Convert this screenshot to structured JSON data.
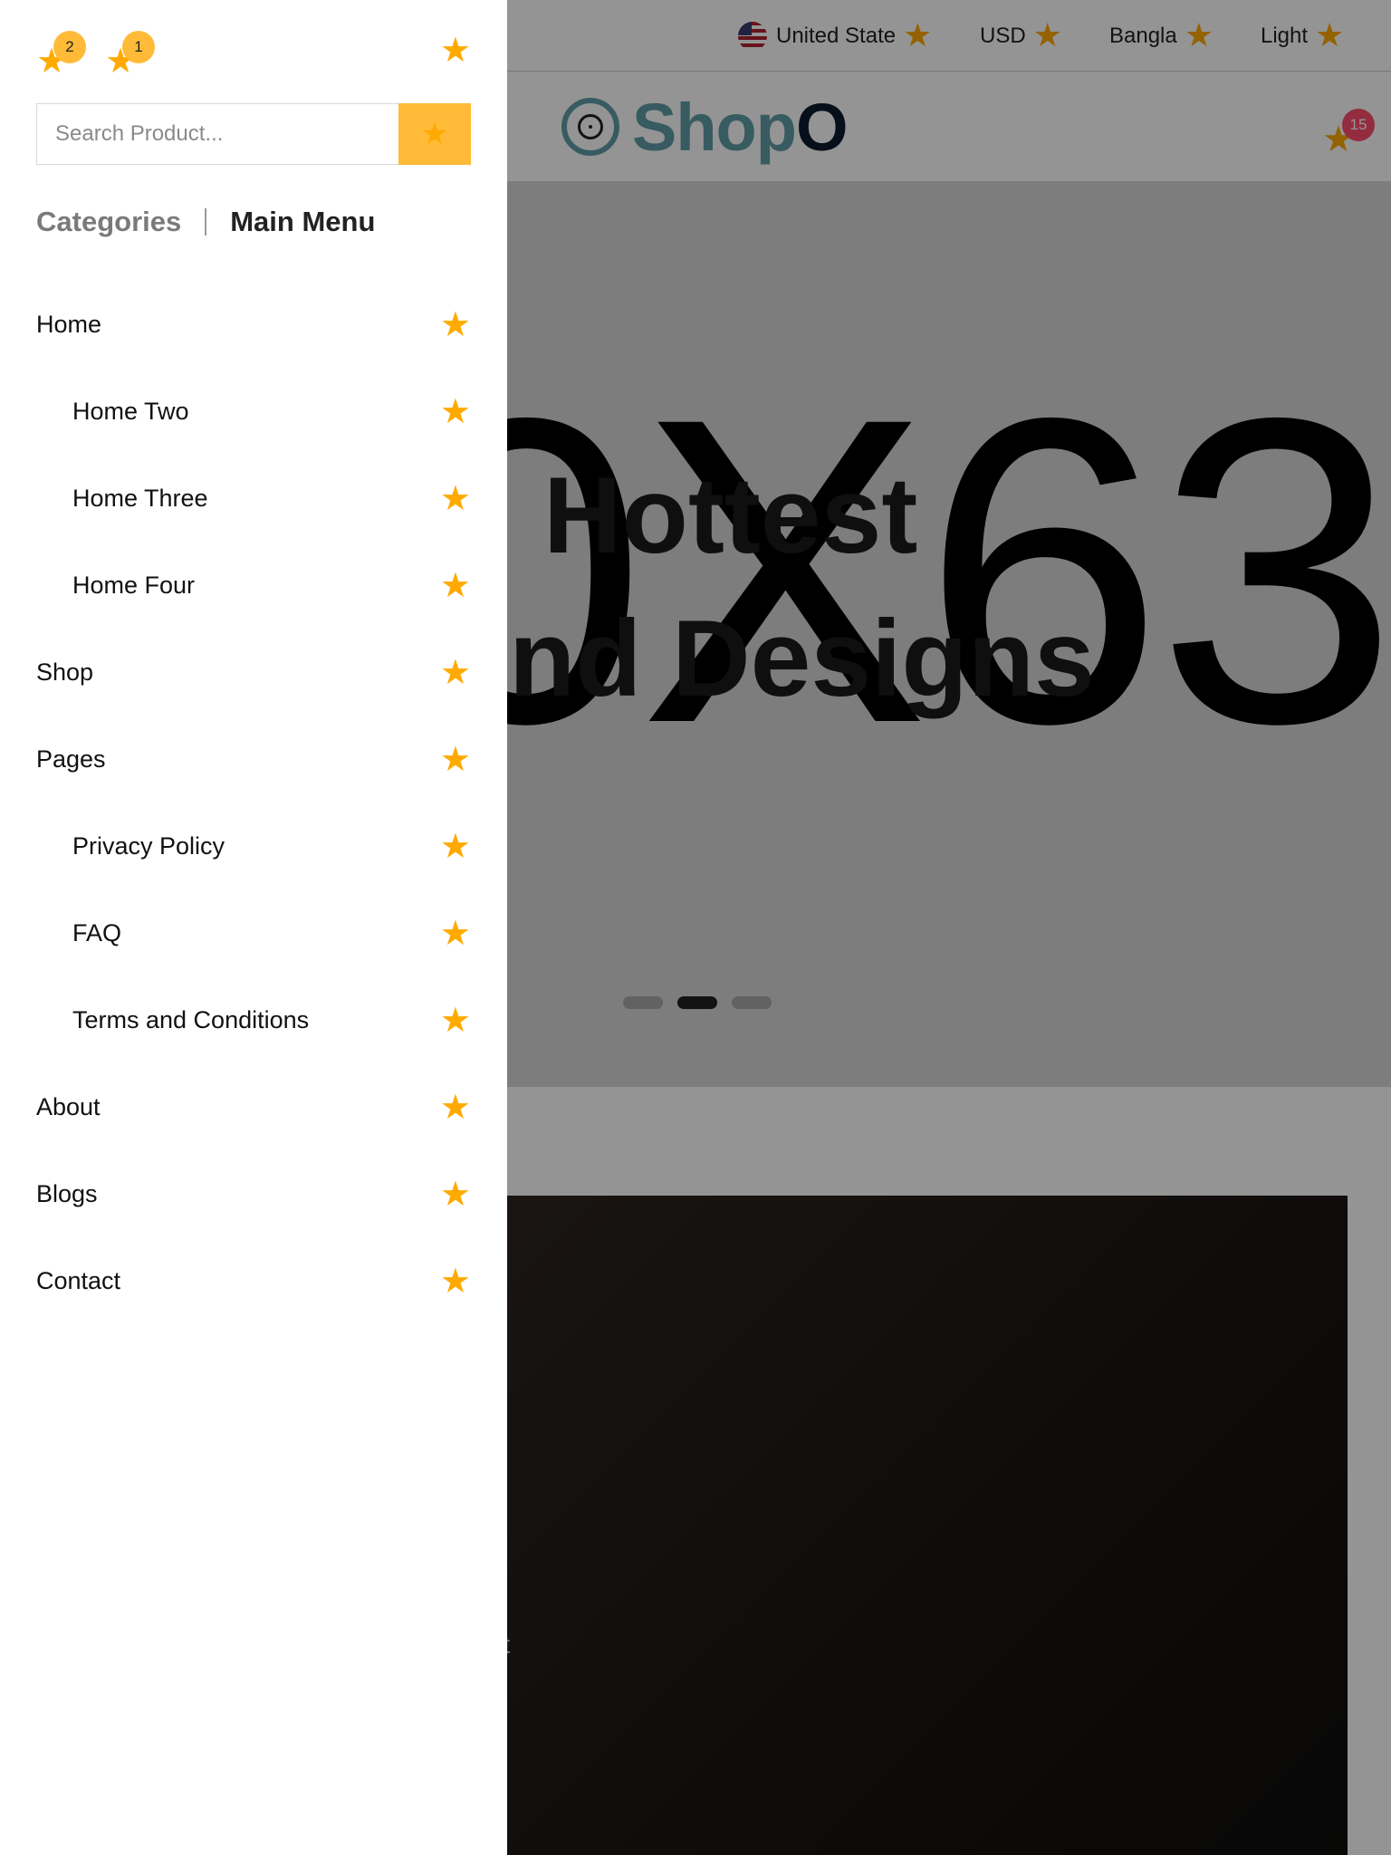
{
  "topbar": {
    "country": "United State",
    "currency": "USD",
    "language": "Bangla",
    "theme": "Light",
    "dropdown_icon": "star-icon",
    "flag_icon": "us-flag-icon"
  },
  "header": {
    "logo_text_main": "Shop",
    "logo_text_accent": "O",
    "cart_badge": "15",
    "cart_icon": "star-icon"
  },
  "hero": {
    "placeholder_text": "0X63",
    "headline_line1": "Hottest",
    "headline_line2": "nd Designs",
    "slides": 3,
    "active_slide": 2
  },
  "banner": {
    "partial_text": "nt"
  },
  "drawer": {
    "wishlist_badge": "2",
    "compare_badge": "1",
    "search_placeholder": "Search Product...",
    "tabs": {
      "categories": "Categories",
      "main_menu": "Main Menu"
    },
    "menu_items": [
      {
        "label": "Home",
        "sub": false
      },
      {
        "label": "Home Two",
        "sub": true
      },
      {
        "label": "Home Three",
        "sub": true
      },
      {
        "label": "Home Four",
        "sub": true
      },
      {
        "label": "Shop",
        "sub": false
      },
      {
        "label": "Pages",
        "sub": false
      },
      {
        "label": "Privacy Policy",
        "sub": true
      },
      {
        "label": "FAQ",
        "sub": true
      },
      {
        "label": "Terms and Conditions",
        "sub": true
      },
      {
        "label": "About",
        "sub": false
      },
      {
        "label": "Blogs",
        "sub": false
      },
      {
        "label": "Contact",
        "sub": false
      }
    ]
  },
  "colors": {
    "accent": "#ffbb38",
    "icon": "#ffaa00",
    "logo": "#5f9ea8",
    "cart_badge": "#ff4d6d"
  }
}
